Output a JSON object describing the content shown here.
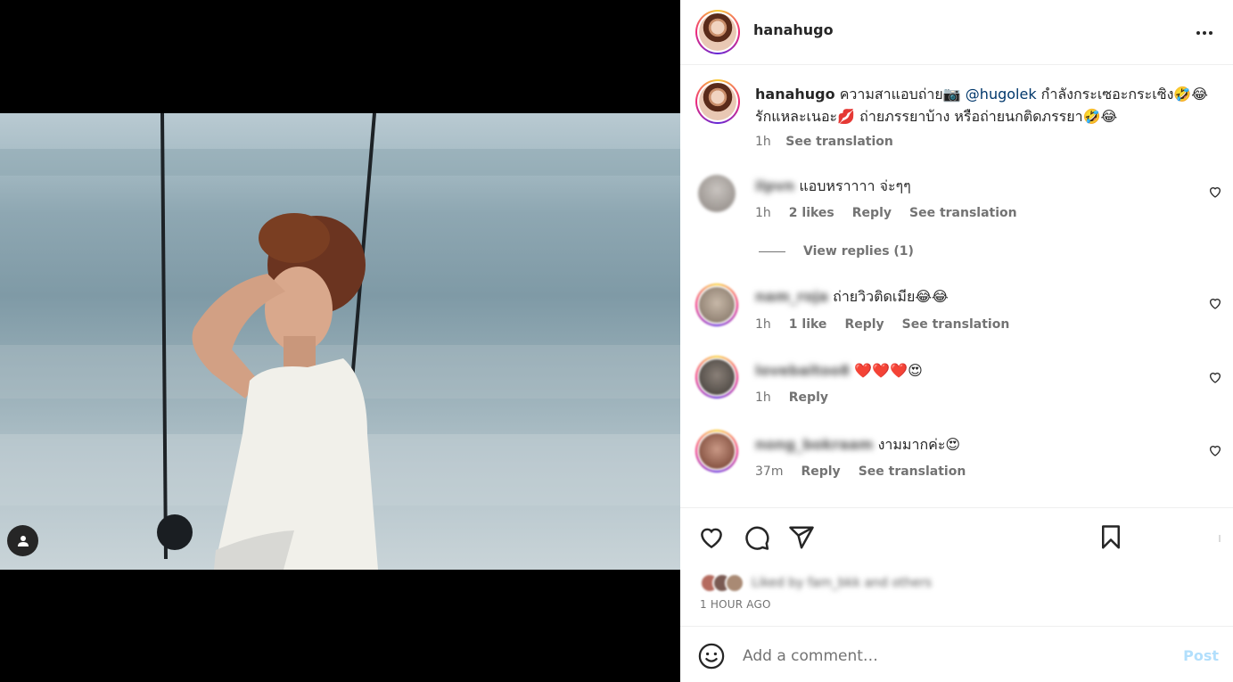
{
  "post": {
    "username": "hanahugo",
    "caption_user": "hanahugo",
    "caption_text_1": " ความสาแอบถ่าย📷 ",
    "caption_mention": "@hugolek",
    "caption_text_2": " กำลังกระเซอะกระเซิง🤣😂 รักแหละเนอะ💋 ถ่ายภรรยาบ้าง หรือถ่ายนกติดภรรยา🤣😂",
    "caption_time": "1h",
    "see_translation": "See translation",
    "likes_summary": "Liked by fam_bkk and others",
    "posted_ago": "1 HOUR AGO"
  },
  "comments": [
    {
      "user": "ilpvn",
      "text": "แอบหราาาา จ่ะๆๆ",
      "time": "1h",
      "likes": "2 likes",
      "reply": "Reply",
      "translate": "See translation"
    },
    {
      "user": "nam_roja",
      "text": "ถ่ายวิวติดเมีย😂😂",
      "time": "1h",
      "likes": "1 like",
      "reply": "Reply",
      "translate": "See translation"
    },
    {
      "user": "lovebaitoo8",
      "text": "❤️❤️❤️😍",
      "time": "1h",
      "reply": "Reply"
    },
    {
      "user": "nong_bokraam",
      "text": "งามมากค่ะ😍",
      "time": "37m",
      "reply": "Reply",
      "translate": "See translation"
    }
  ],
  "view_replies": "View replies (1)",
  "composer": {
    "placeholder": "Add a comment…",
    "post_label": "Post"
  },
  "colors": {
    "mention": "#00376b",
    "muted": "#737373",
    "post_disabled": "#b2dffc"
  }
}
